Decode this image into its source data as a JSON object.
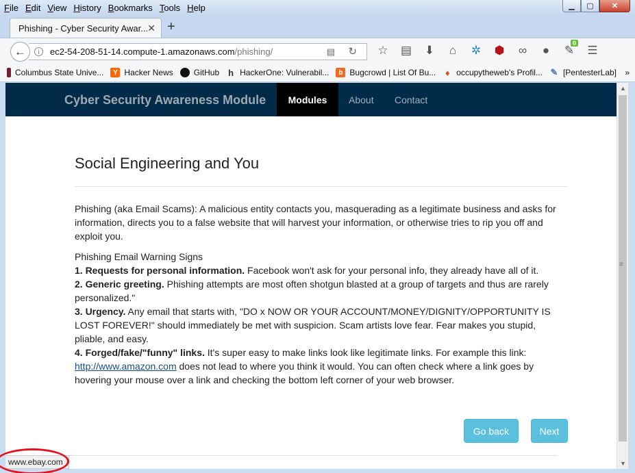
{
  "menu": [
    "File",
    "Edit",
    "View",
    "History",
    "Bookmarks",
    "Tools",
    "Help"
  ],
  "window_controls": {
    "minimize": "▁",
    "maximize": "▢",
    "close": "✕"
  },
  "tab": {
    "title": "Phishing - Cyber Security Awar...",
    "close": "✕",
    "new_tab": "+"
  },
  "url": {
    "host": "ec2-54-208-51-14.compute-1.amazonaws.com",
    "path": "/phishing/"
  },
  "toolbar_badge": "0",
  "bookmarks": [
    {
      "label": "Columbus State Unive...",
      "icon": "columbus-state-icon",
      "color": "#7a1b2e",
      "glyph": "▮"
    },
    {
      "label": "Hacker News",
      "icon": "hacker-news-icon",
      "color": "#ff6600",
      "glyph": "Y"
    },
    {
      "label": "GitHub",
      "icon": "github-icon",
      "color": "#111111",
      "glyph": "●"
    },
    {
      "label": "HackerOne: Vulnerabil...",
      "icon": "hackerone-icon",
      "color": "#333333",
      "glyph": "h"
    },
    {
      "label": "Bugcrowd | List Of Bu...",
      "icon": "bugcrowd-icon",
      "color": "#f26822",
      "glyph": "b"
    },
    {
      "label": "occupytheweb's Profil...",
      "icon": "flame-icon",
      "color": "#d9531e",
      "glyph": "♦"
    },
    {
      "label": "[PentesterLab]",
      "icon": "pentesterlab-icon",
      "color": "#8aa4c0",
      "glyph": "✎"
    }
  ],
  "bookmarks_overflow": "»",
  "site": {
    "brand": "Cyber Security Awareness Module",
    "nav": [
      "Modules",
      "About",
      "Contact"
    ]
  },
  "article": {
    "title": "Social Engineering and You",
    "intro": "Phishing (aka Email Scams): A malicious entity contacts you, masquerading as a legitimate business and asks for information, directs you to a false website that will harvest your information, or otherwise tries to rip you off and exploit you.",
    "signs_heading": "Phishing Email Warning Signs",
    "sign1_bold": "1. Requests for personal information.",
    "sign1_text": " Facebook won't ask for your personal info, they already have all of it.",
    "sign2_bold": "2. Generic greeting.",
    "sign2_text": " Phishing attempts are most often shotgun blasted at a group of targets and thus are rarely personalized.\"",
    "sign3_bold": "3. Urgency.",
    "sign3_text": " Any email that starts with, \"DO x NOW OR YOUR ACCOUNT/MONEY/DIGNITY/OPPORTUNITY IS LOST FOREVER!\" should immediately be met with suspicion. Scam artists love fear. Fear makes you stupid, pliable, and easy.",
    "sign4_bold": "4. Forged/fake/\"funny\" links.",
    "sign4_text": " It's super easy to make links look like legitimate links. For example this link: ",
    "link_text": "http://www.amazon.com",
    "sign4_tail": " does not lead to where you think it would. You can often check where a link goes by hovering your mouse over a link and checking the bottom left corner of your web browser."
  },
  "buttons": {
    "back": "Go back",
    "next": "Next"
  },
  "status_url": "www.ebay.com",
  "colors": {
    "navbar": "#022a49",
    "button": "#5bc0de",
    "annotation": "#e0131f"
  }
}
